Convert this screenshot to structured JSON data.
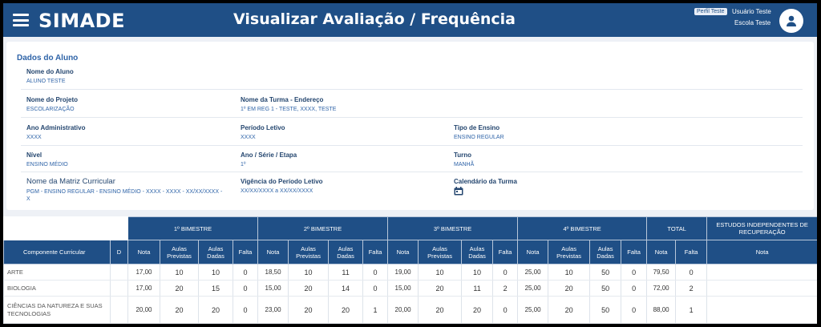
{
  "header": {
    "logo": "SIMADE",
    "title": "Visualizar Avaliação / Frequência",
    "profile_badge": "Perfil Teste",
    "user_name": "Usuário Teste",
    "school_name": "Escola Teste"
  },
  "student": {
    "section_title": "Dados do Aluno",
    "name": {
      "label": "Nome do Aluno",
      "value": "ALUNO TESTE"
    },
    "project": {
      "label": "Nome do Projeto",
      "value": "ESCOLARIZAÇÃO"
    },
    "class_address": {
      "label": "Nome da Turma - Endereço",
      "value": "1º EM REG 1 - TESTE, XXXX, TESTE"
    },
    "admin_year": {
      "label": "Ano Administrativo",
      "value": "XXXX"
    },
    "school_period": {
      "label": "Período Letivo",
      "value": "XXXX"
    },
    "teaching_type": {
      "label": "Tipo de Ensino",
      "value": "ENSINO REGULAR"
    },
    "level": {
      "label": "Nível",
      "value": "ENSINO MÉDIO"
    },
    "grade_stage": {
      "label": "Ano / Série / Etapa",
      "value": "1º"
    },
    "shift": {
      "label": "Turno",
      "value": "MANHÃ"
    },
    "curriculum": {
      "label": "Nome da Matriz Curricular",
      "value": "PGM - ENSINO REGULAR - ENSINO MÉDIO - XXXX - XXXX - XX/XX/XXXX - X"
    },
    "period_validity": {
      "label": "Vigência do Período Letivo",
      "value": "XX/XX/XXXX a XX/XX/XXXX"
    },
    "class_calendar": {
      "label": "Calendário da Turma"
    }
  },
  "table": {
    "groups": [
      "1º BIMESTRE",
      "2º BIMESTRE",
      "3º BIMESTRE",
      "4º BIMESTRE",
      "TOTAL",
      "ESTUDOS INDEPENDENTES DE RECUPERAÇÃO"
    ],
    "col_subject": "Componente Curricular",
    "col_d": "D",
    "col_nota": "Nota",
    "col_aulas_previstas": "Aulas Previstas",
    "col_aulas_dadas": "Aulas Dadas",
    "col_falta": "Falta",
    "rows": [
      {
        "subject": "ARTE",
        "d": "",
        "values": [
          "17,00",
          "10",
          "10",
          "0",
          "18,50",
          "10",
          "11",
          "0",
          "19,00",
          "10",
          "10",
          "0",
          "25,00",
          "10",
          "50",
          "0",
          "79,50",
          "0"
        ],
        "rec": ""
      },
      {
        "subject": "BIOLOGIA",
        "d": "",
        "values": [
          "17,00",
          "20",
          "15",
          "0",
          "15,00",
          "20",
          "14",
          "0",
          "15,00",
          "20",
          "11",
          "2",
          "25,00",
          "20",
          "50",
          "0",
          "72,00",
          "2"
        ],
        "rec": ""
      },
      {
        "subject": "CIÊNCIAS DA NATUREZA E SUAS TECNOLOGIAS",
        "d": "",
        "values": [
          "20,00",
          "20",
          "20",
          "0",
          "23,00",
          "20",
          "20",
          "1",
          "20,00",
          "20",
          "20",
          "0",
          "25,00",
          "20",
          "50",
          "0",
          "88,00",
          "1"
        ],
        "rec": ""
      }
    ]
  }
}
